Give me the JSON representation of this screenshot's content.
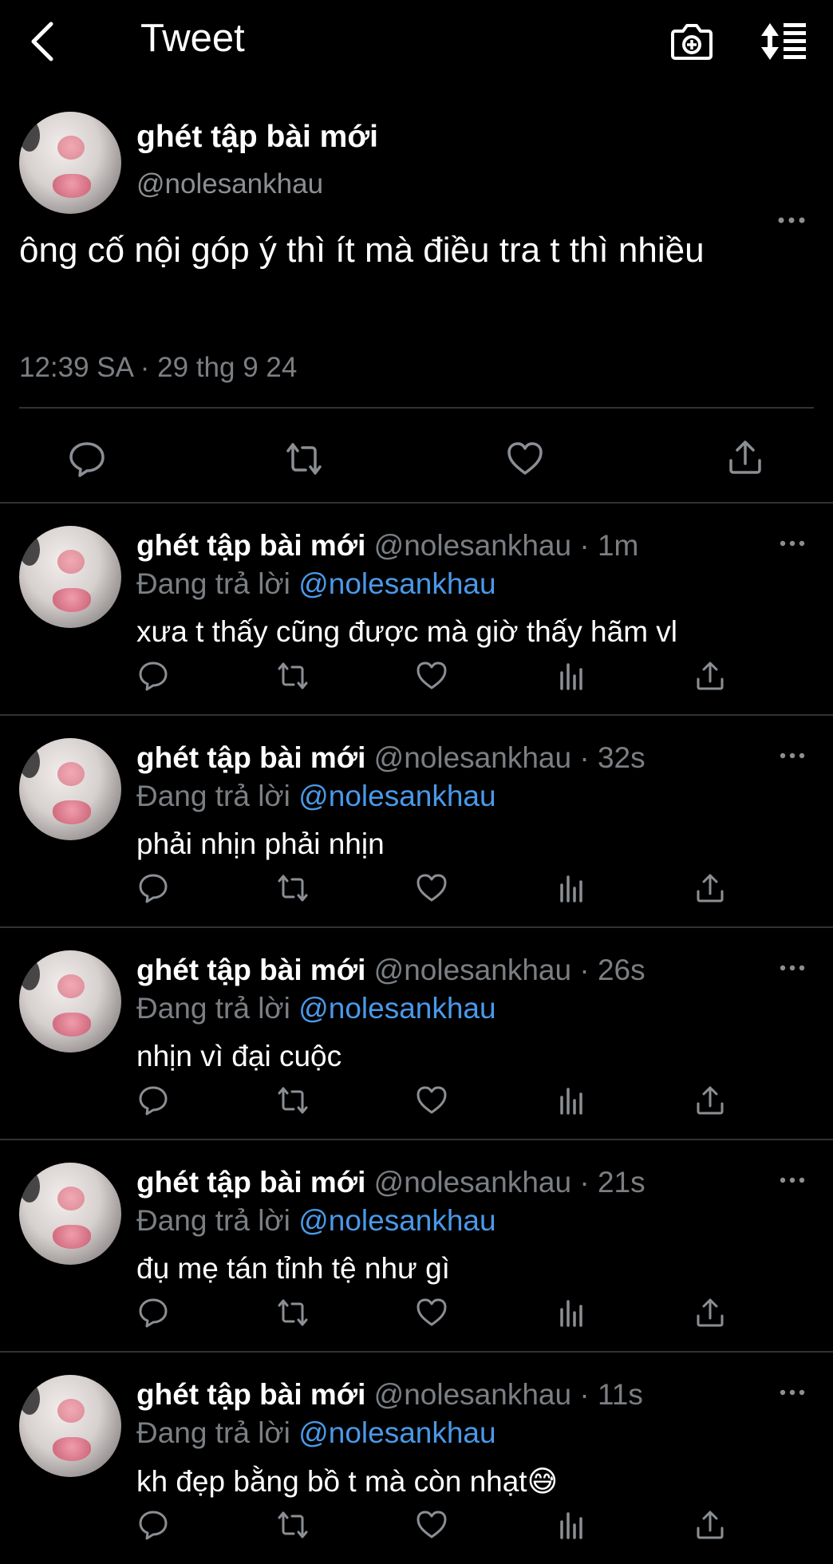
{
  "header": {
    "title": "Tweet",
    "back_icon": "chevron-left-icon",
    "camera_icon": "camera-plus-icon",
    "sort_icon": "sort-list-icon"
  },
  "main_tweet": {
    "name": "ghét tập bài mới",
    "handle": "@nolesankhau",
    "text": "ông cố nội góp ý thì ít mà điều tra t thì nhiều",
    "timestamp": "12:39 SA · 29 thg 9 24"
  },
  "replies": [
    {
      "name": "ghét tập bài mới",
      "meta": "@nolesankhau · 1m",
      "replying_prefix": "Đang trả lời",
      "mention": "@nolesankhau",
      "text": "xưa t thấy cũng được mà giờ thấy hãm vl"
    },
    {
      "name": "ghét tập bài mới",
      "meta": "@nolesankhau · 32s",
      "replying_prefix": "Đang trả lời",
      "mention": "@nolesankhau",
      "text": "phải nhịn phải nhịn"
    },
    {
      "name": "ghét tập bài mới",
      "meta": "@nolesankhau · 26s",
      "replying_prefix": "Đang trả lời",
      "mention": "@nolesankhau",
      "text": "nhịn vì đại cuộc"
    },
    {
      "name": "ghét tập bài mới",
      "meta": "@nolesankhau · 21s",
      "replying_prefix": "Đang trả lời",
      "mention": "@nolesankhau",
      "text": "đụ mẹ tán tỉnh tệ như gì"
    },
    {
      "name": "ghét tập bài mới",
      "meta": "@nolesankhau · 11s",
      "replying_prefix": "Đang trả lời",
      "mention": "@nolesankhau",
      "text": "kh đẹp bằng bồ t mà còn nhạt😅"
    }
  ],
  "colors": {
    "background": "#000000",
    "text": "#ffffff",
    "secondary": "#7b7f83",
    "link": "#4a99e9",
    "divider": "#2f3336"
  }
}
